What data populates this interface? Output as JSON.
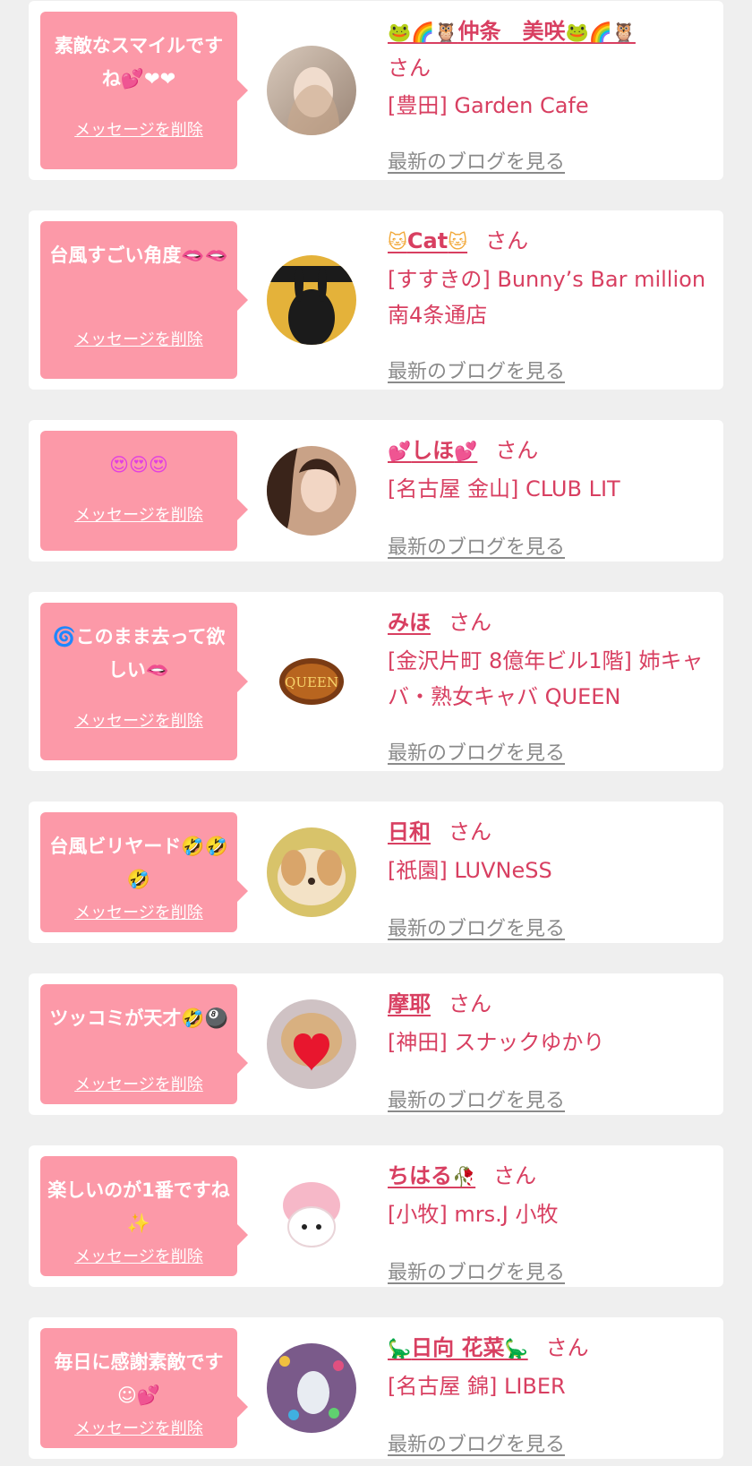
{
  "cards": [
    {
      "message": "素敵なスマイルですね💕❤❤",
      "delete_label": "メッセージを削除",
      "name_prefix": "🐸🌈🦉",
      "name": "仲条　美咲",
      "name_suffix": "🐸🌈🦉",
      "san": "さん",
      "shop": "[豊田] Garden Cafe",
      "blog_label": "最新のブログを見る"
    },
    {
      "message": "台風すごい角度🫦🫦",
      "delete_label": "メッセージを削除",
      "name_prefix": "🐱",
      "name": "Cat",
      "name_suffix": "🐱",
      "san": "さん",
      "shop": "[すすきの] Bunny’s Bar million 南4条通店",
      "blog_label": "最新のブログを見る"
    },
    {
      "message": "😍😍😍",
      "delete_label": "メッセージを削除",
      "name_prefix": "💕",
      "name": "しほ",
      "name_suffix": "💕",
      "san": "さん",
      "shop": "[名古屋 金山] CLUB LIT",
      "blog_label": "最新のブログを見る"
    },
    {
      "message": "🌀このまま去って欲しい🫦",
      "delete_label": "メッセージを削除",
      "name_prefix": "",
      "name": "みほ",
      "name_suffix": "",
      "san": "さん",
      "shop": "[金沢片町 8億年ビル1階] 姉キャバ・熟女キャバ QUEEN",
      "blog_label": "最新のブログを見る"
    },
    {
      "message": "台風ビリヤード🤣🤣🤣",
      "delete_label": "メッセージを削除",
      "name_prefix": "",
      "name": "日和",
      "name_suffix": "",
      "san": "さん",
      "shop": "[祇園] LUVNeSS",
      "blog_label": "最新のブログを見る"
    },
    {
      "message": "ツッコミが天才🤣🎱",
      "delete_label": "メッセージを削除",
      "name_prefix": "",
      "name": "摩耶",
      "name_suffix": "",
      "san": "さん",
      "shop": "[神田] スナックゆかり",
      "blog_label": "最新のブログを見る"
    },
    {
      "message": "楽しいのが1番ですね✨",
      "delete_label": "メッセージを削除",
      "name_prefix": "",
      "name": "ちはる",
      "name_suffix": "🥀",
      "san": "さん",
      "shop": "[小牧] mrs.J 小牧",
      "blog_label": "最新のブログを見る"
    },
    {
      "message": "毎日に感謝素敵です☺💕",
      "delete_label": "メッセージを削除",
      "name_prefix": "🦕",
      "name": "日向 花菜",
      "name_suffix": "🦕",
      "san": "さん",
      "shop": "[名古屋 錦] LIBER",
      "blog_label": "最新のブログを見る"
    }
  ],
  "colors": {
    "bubble": "#fc99a8",
    "name": "#d83f61",
    "blog_link": "#8a8a8a",
    "background": "#efefef"
  }
}
